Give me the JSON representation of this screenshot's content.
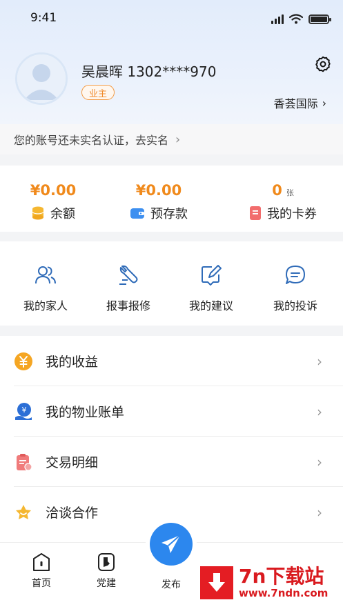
{
  "status_bar": {
    "time": "9:41"
  },
  "profile": {
    "name_phone": "吴晨晖 1302****970",
    "role": "业主",
    "community": "香荟国际"
  },
  "verify_notice": "您的账号还未实名认证，去实名",
  "wallet": [
    {
      "amount": "¥0.00",
      "unit": "",
      "label": "余额",
      "icon": "coin-stack-icon"
    },
    {
      "amount": "¥0.00",
      "unit": "",
      "label": "预存款",
      "icon": "wallet-icon"
    },
    {
      "amount": "0",
      "unit": "张",
      "label": "我的卡券",
      "icon": "coupon-icon"
    }
  ],
  "services": [
    {
      "label": "我的家人",
      "icon": "family-icon"
    },
    {
      "label": "报事报修",
      "icon": "repair-icon"
    },
    {
      "label": "我的建议",
      "icon": "suggestion-icon"
    },
    {
      "label": "我的投诉",
      "icon": "complaint-icon"
    }
  ],
  "menu": [
    {
      "label": "我的收益",
      "icon": "yuan-coin-icon"
    },
    {
      "label": "我的物业账单",
      "icon": "bill-icon"
    },
    {
      "label": "交易明细",
      "icon": "transaction-icon"
    },
    {
      "label": "洽谈合作",
      "icon": "cooperation-icon"
    }
  ],
  "tabbar": {
    "home": "首页",
    "party": "党建",
    "publish": "发布"
  },
  "watermark": {
    "title": "7n下载站",
    "url": "www.7ndn.com"
  },
  "colors": {
    "accent": "#2c87ee",
    "orange": "#f08a1c",
    "badge": "#f29a44"
  }
}
